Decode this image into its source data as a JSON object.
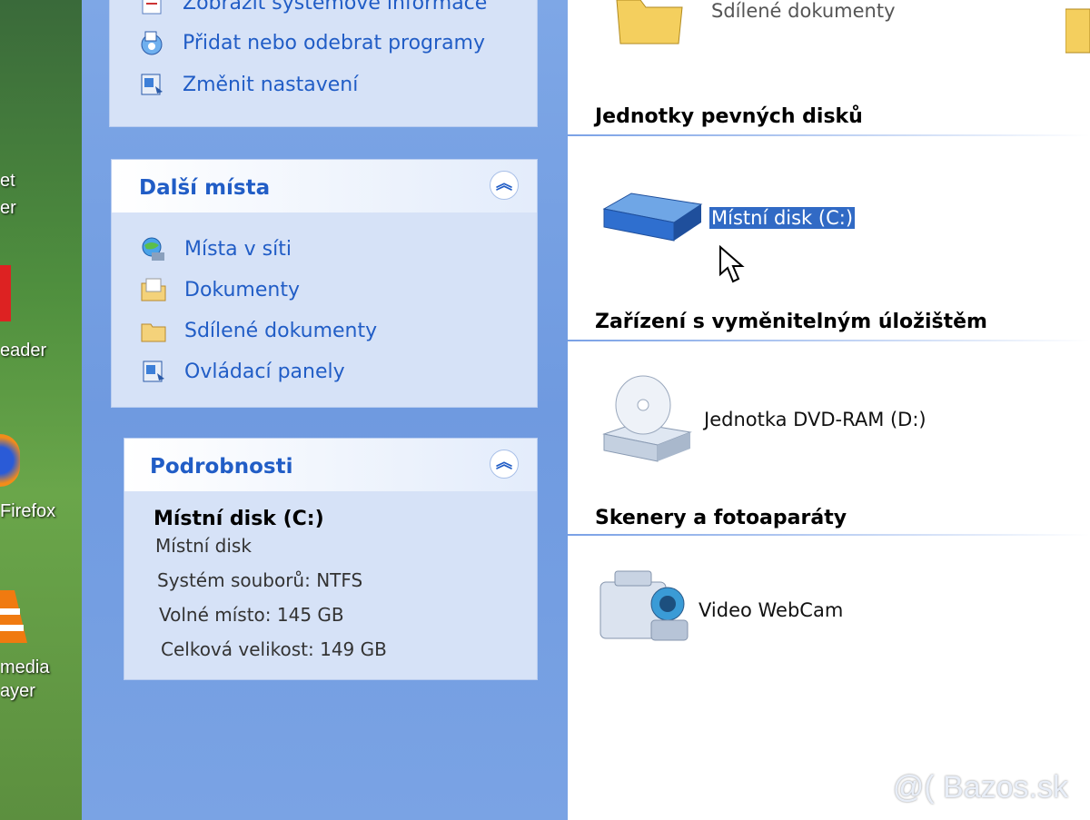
{
  "desktop": {
    "items": [
      {
        "label": "et"
      },
      {
        "label": "er"
      },
      {
        "label": "eader"
      },
      {
        "label": "Firefox"
      },
      {
        "label": "media"
      },
      {
        "label": "ayer"
      }
    ]
  },
  "system_tasks": {
    "links": [
      {
        "label": "Zobrazit systémové informace",
        "icon": "system-info-icon"
      },
      {
        "label": "Přidat nebo odebrat programy",
        "icon": "add-remove-programs-icon"
      },
      {
        "label": "Změnit nastavení",
        "icon": "control-panel-icon"
      }
    ]
  },
  "other_places": {
    "title": "Další místa",
    "links": [
      {
        "label": "Místa v síti",
        "icon": "network-places-icon"
      },
      {
        "label": "Dokumenty",
        "icon": "documents-icon"
      },
      {
        "label": "Sdílené dokumenty",
        "icon": "shared-folder-icon"
      },
      {
        "label": "Ovládací panely",
        "icon": "control-panel-icon"
      }
    ]
  },
  "details": {
    "title": "Podrobnosti",
    "name": "Místní disk (C:)",
    "type": "Místní disk",
    "filesystem": "Systém souborů: NTFS",
    "free_space": "Volné místo: 145 GB",
    "total_size": "Celková velikost: 149 GB"
  },
  "content": {
    "top_item": {
      "label": "Sdílené dokumenty"
    },
    "groups": [
      {
        "title": "Jednotky pevných disků",
        "items": [
          {
            "label": "Místní disk (C:)",
            "selected": true
          }
        ]
      },
      {
        "title": "Zařízení s vyměnitelným úložištěm",
        "items": [
          {
            "label": "Jednotka DVD-RAM (D:)"
          }
        ]
      },
      {
        "title": "Skenery a fotoaparáty",
        "items": [
          {
            "label": "Video WebCam"
          }
        ]
      }
    ]
  },
  "watermark": "@( Bazos.sk",
  "colors": {
    "link": "#215dc6",
    "taskpane": "#7ea7e6",
    "selection": "#316ac5"
  }
}
